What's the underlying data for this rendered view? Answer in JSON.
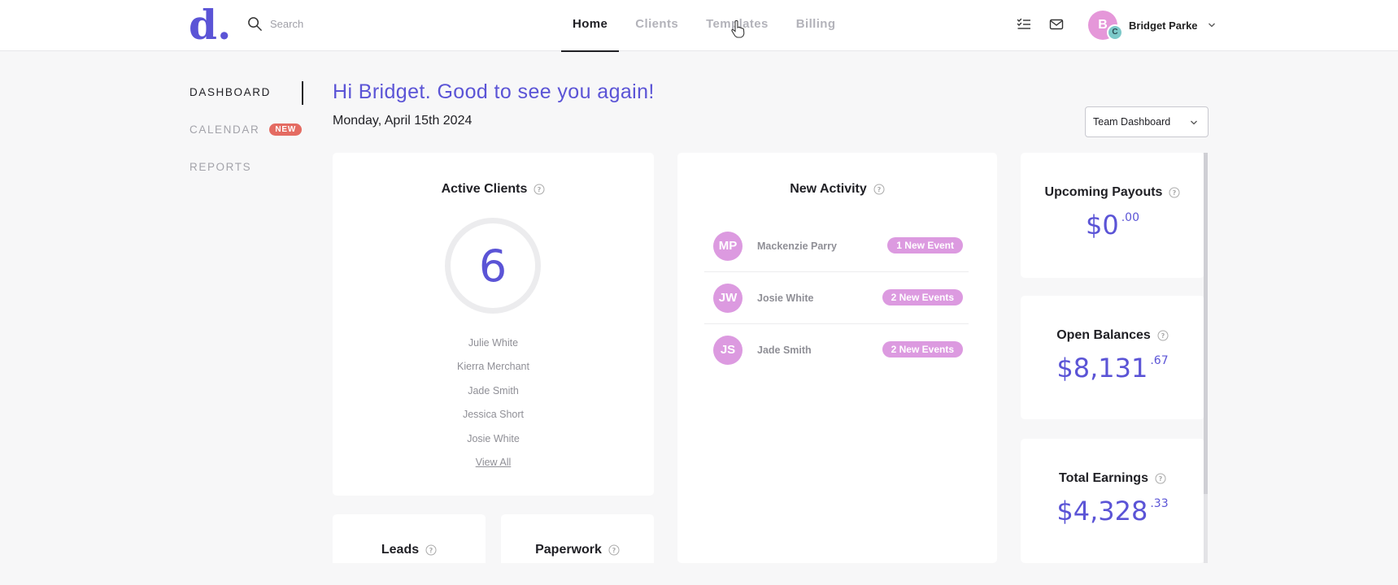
{
  "logo": {
    "letter": "d",
    "dot": "."
  },
  "search": {
    "placeholder": "Search"
  },
  "nav": {
    "tabs": [
      {
        "label": "Home",
        "active": true
      },
      {
        "label": "Clients",
        "active": false
      },
      {
        "label": "Templates",
        "active": false
      },
      {
        "label": "Billing",
        "active": false
      }
    ]
  },
  "user": {
    "initial": "B",
    "badge_initial": "C",
    "name": "Bridget Parke"
  },
  "sidebar": {
    "items": [
      {
        "label": "DASHBOARD",
        "active": true
      },
      {
        "label": "CALENDAR",
        "badge": "NEW"
      },
      {
        "label": "REPORTS"
      }
    ]
  },
  "greeting": "Hi Bridget. Good to see you again!",
  "date": "Monday, April 15th 2024",
  "dashboard_select": {
    "value": "Team Dashboard"
  },
  "active_clients": {
    "title": "Active Clients",
    "count": "6",
    "clients": [
      "Julie White",
      "Kierra Merchant",
      "Jade Smith",
      "Jessica Short",
      "Josie White"
    ],
    "view_all": "View All"
  },
  "new_activity": {
    "title": "New Activity",
    "items": [
      {
        "initials": "MP",
        "name": "Mackenzie Parry",
        "badge": "1 New Event"
      },
      {
        "initials": "JW",
        "name": "Josie White",
        "badge": "2 New Events"
      },
      {
        "initials": "JS",
        "name": "Jade Smith",
        "badge": "2 New Events"
      }
    ]
  },
  "upcoming_payouts": {
    "title": "Upcoming Payouts",
    "amount": "$0",
    "cents": ".00"
  },
  "open_balances": {
    "title": "Open Balances",
    "amount": "$8,131",
    "cents": ".67"
  },
  "total_earnings": {
    "title": "Total Earnings",
    "amount": "$4,328",
    "cents": ".33"
  },
  "leads": {
    "title": "Leads"
  },
  "paperwork": {
    "title": "Paperwork"
  },
  "colors": {
    "accent": "#5b54d6",
    "badge_pink": "#dc9ae0",
    "new_badge": "#e46b62"
  },
  "icons": [
    "search-icon",
    "checklist-icon",
    "mail-icon",
    "chevron-down-icon",
    "help-circle-icon",
    "pointer-cursor-icon"
  ]
}
